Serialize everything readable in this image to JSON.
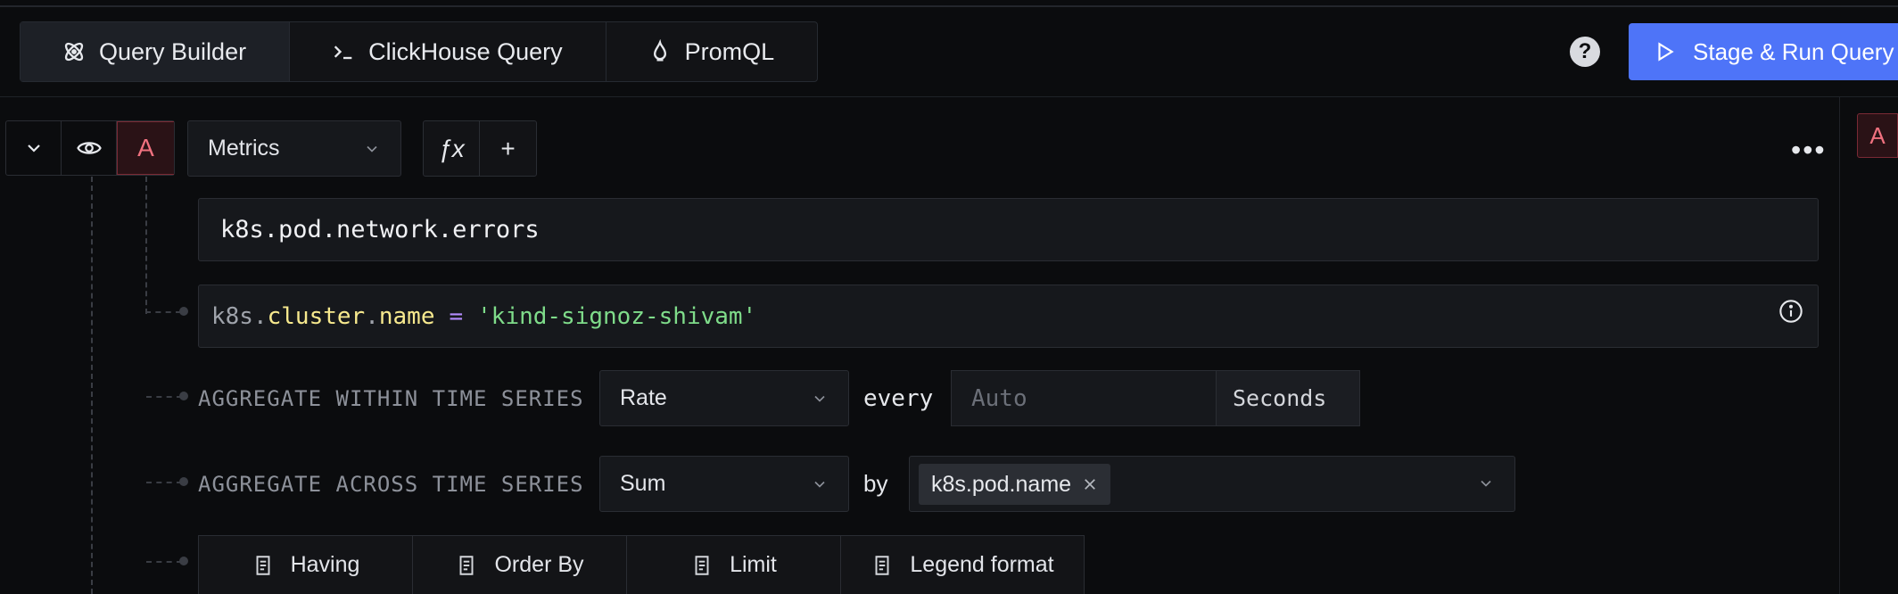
{
  "tabs": [
    {
      "label": "Query Builder",
      "icon": "atom-icon",
      "active": true
    },
    {
      "label": "ClickHouse Query",
      "icon": "terminal-icon",
      "active": false
    },
    {
      "label": "PromQL",
      "icon": "flame-icon",
      "active": false
    }
  ],
  "header": {
    "help_label": "?",
    "run_label": "Stage & Run Query"
  },
  "query": {
    "letter": "A",
    "data_source": "Metrics",
    "fx_label": "ƒx",
    "add_label": "+",
    "more_label": "•••",
    "metric_name": "k8s.pod.network.errors",
    "filter": {
      "prefix": "k8s.",
      "key_part1": "cluster",
      "dot": ".",
      "key_part2": "name",
      "operator": "=",
      "value": "'kind-signoz-shivam'"
    },
    "within": {
      "label": "AGGREGATE WITHIN TIME SERIES",
      "value": "Rate",
      "every_label": "every",
      "interval_placeholder": "Auto",
      "unit": "Seconds"
    },
    "across": {
      "label": "AGGREGATE ACROSS TIME SERIES",
      "value": "Sum",
      "by_label": "by",
      "group_by": [
        "k8s.pod.name"
      ]
    },
    "options": [
      {
        "label": "Having"
      },
      {
        "label": "Order By"
      },
      {
        "label": "Limit"
      },
      {
        "label": "Legend format"
      }
    ]
  },
  "side_panel": {
    "letter": "A"
  },
  "colors": {
    "accent": "#4e74f8",
    "query_letter": "#f0717f",
    "filter_key": "#f7e98e",
    "filter_value": "#7fdc8a",
    "filter_operator": "#b48cff"
  }
}
